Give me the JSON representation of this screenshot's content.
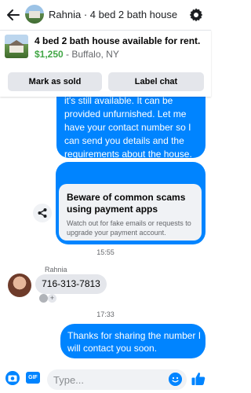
{
  "header": {
    "contact_name": "Rahnia",
    "separator": " · ",
    "listing_short": "4 bed 2 bath house"
  },
  "listing": {
    "title": "4 bed 2 bath house available for rent.",
    "price": "$1,250",
    "location_suffix": " - Buffalo, NY",
    "mark_sold_label": "Mark as sold",
    "label_chat_label": "Label chat"
  },
  "messages": {
    "outgoing_1": "it's still available. It can be provided unfurnished. Let me have your contact number so I can send you details and the requirements about the house.",
    "scam_card": {
      "title": "Beware of common scams using payment apps",
      "body": "Watch out for fake emails or requests to upgrade your payment account."
    },
    "time_1": "15:55",
    "sender_name": "Rahnia",
    "incoming_1": "716-313-7813",
    "time_2": "17:33",
    "outgoing_2": "Thanks for sharing the number I will contact you soon."
  },
  "composer": {
    "placeholder": "Type...",
    "gif_label": "GIF"
  },
  "colors": {
    "accent": "#0084ff",
    "price": "#42a746",
    "bubble_in": "#e4e6eb"
  },
  "icons": [
    "back-arrow-icon",
    "gear-icon",
    "share-icon",
    "camera-icon",
    "gif-icon",
    "emoji-icon",
    "thumbs-up-icon",
    "reaction-icon"
  ]
}
